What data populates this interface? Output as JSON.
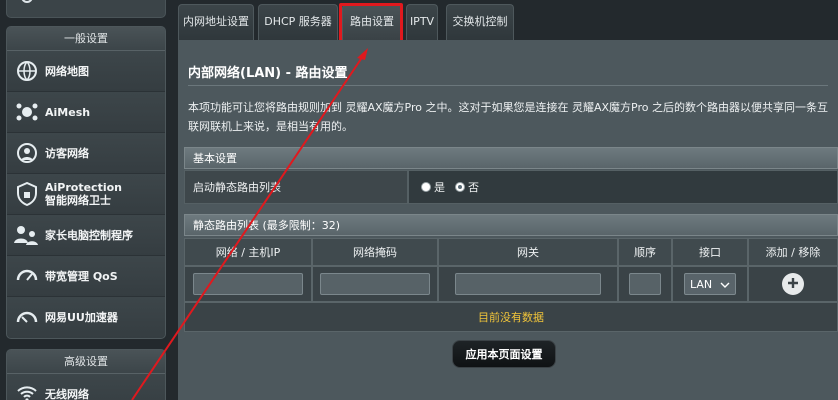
{
  "sidebar": {
    "group_general": {
      "header": "一般设置",
      "items": [
        {
          "label": "网络地图",
          "icon": "network-map-icon"
        },
        {
          "label": "AiMesh",
          "icon": "aimesh-icon"
        },
        {
          "label": "访客网络",
          "icon": "guest-network-icon"
        },
        {
          "label": "AiProtection",
          "label2": "智能网络卫士",
          "icon": "shield-icon"
        },
        {
          "label": "家长电脑控制程序",
          "icon": "parental-control-icon"
        },
        {
          "label": "带宽管理 QoS",
          "icon": "speedometer-icon"
        },
        {
          "label": "网易UU加速器",
          "icon": "uu-accelerator-icon"
        }
      ]
    },
    "group_advanced": {
      "header": "高级设置",
      "items": [
        {
          "label": "无线网络",
          "icon": "wifi-icon"
        }
      ]
    }
  },
  "tabs": [
    {
      "label": "内网地址设置"
    },
    {
      "label": "DHCP 服务器"
    },
    {
      "label": "路由设置",
      "active": true
    },
    {
      "label": "IPTV"
    },
    {
      "label": "交换机控制"
    }
  ],
  "page": {
    "title": "内部网络(LAN) - 路由设置",
    "description": "本项功能可让您将路由规则加到 灵耀AX魔方Pro 之中。这对于如果您是连接在 灵耀AX魔方Pro 之后的数个路由器以便共享同一条互联网联机上来说，是相当有用的。"
  },
  "basic": {
    "header": "基本设置",
    "label": "启动静态路由列表",
    "options": [
      "是",
      "否"
    ],
    "selected": "否"
  },
  "route_table": {
    "header": "静态路由列表 (最多限制：32)",
    "columns": [
      "网络 / 主机IP",
      "网络掩码",
      "网关",
      "顺序",
      "接口",
      "添加 / 移除"
    ],
    "interface_value": "LAN",
    "empty_text": "目前没有数据"
  },
  "apply_label": "应用本页面设置",
  "colors": {
    "highlight": "#e0191e",
    "empty_text": "#f0c43a"
  }
}
